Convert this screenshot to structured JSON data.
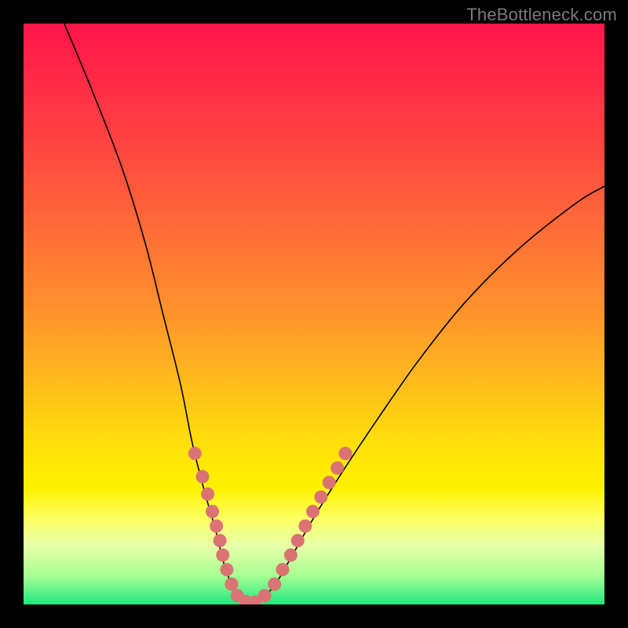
{
  "watermark": "TheBottleneck.com",
  "colors": {
    "black": "#000000",
    "curve": "#000000",
    "marker": "#db7374",
    "gradient_stops": [
      {
        "offset": 0.0,
        "color": "#ff164a"
      },
      {
        "offset": 0.1,
        "color": "#ff2a46"
      },
      {
        "offset": 0.22,
        "color": "#ff4840"
      },
      {
        "offset": 0.35,
        "color": "#ff6b38"
      },
      {
        "offset": 0.48,
        "color": "#ff8e2e"
      },
      {
        "offset": 0.6,
        "color": "#ffb51f"
      },
      {
        "offset": 0.72,
        "color": "#ffde0a"
      },
      {
        "offset": 0.8,
        "color": "#fff200"
      },
      {
        "offset": 0.85,
        "color": "#fcff5e"
      },
      {
        "offset": 0.9,
        "color": "#e6ffa9"
      },
      {
        "offset": 0.95,
        "color": "#a8ff92"
      },
      {
        "offset": 1.0,
        "color": "#21e77f"
      }
    ]
  },
  "chart_data": {
    "type": "line",
    "title": "",
    "xlabel": "",
    "ylabel": "",
    "xlim": [
      0,
      100
    ],
    "ylim": [
      0,
      100
    ],
    "note": "Axes are unlabeled in the image; x/y are normalized 0–100.",
    "series": [
      {
        "name": "bottleneck-curve",
        "x": [
          7,
          12,
          17,
          21,
          24,
          27,
          29,
          31,
          33,
          34.5,
          36,
          37.5,
          40,
          43,
          46,
          50,
          55,
          61,
          68,
          76,
          85,
          95,
          100
        ],
        "y": [
          100,
          88,
          75,
          62,
          50,
          38,
          28,
          20,
          13,
          7,
          3,
          0.5,
          0.5,
          3,
          8,
          15,
          23,
          32,
          42,
          52,
          61,
          69,
          72
        ]
      }
    ],
    "markers": {
      "name": "highlight-dots",
      "points": [
        {
          "x": 29.5,
          "y": 26.0
        },
        {
          "x": 30.8,
          "y": 22.0
        },
        {
          "x": 31.7,
          "y": 19.0
        },
        {
          "x": 32.5,
          "y": 16.0
        },
        {
          "x": 33.2,
          "y": 13.5
        },
        {
          "x": 33.8,
          "y": 11.0
        },
        {
          "x": 34.3,
          "y": 8.5
        },
        {
          "x": 35.0,
          "y": 6.0
        },
        {
          "x": 35.8,
          "y": 3.5
        },
        {
          "x": 36.8,
          "y": 1.5
        },
        {
          "x": 38.3,
          "y": 0.5
        },
        {
          "x": 39.8,
          "y": 0.4
        },
        {
          "x": 41.5,
          "y": 1.5
        },
        {
          "x": 43.2,
          "y": 3.5
        },
        {
          "x": 44.6,
          "y": 6.0
        },
        {
          "x": 46.0,
          "y": 8.5
        },
        {
          "x": 47.2,
          "y": 11.0
        },
        {
          "x": 48.5,
          "y": 13.5
        },
        {
          "x": 49.8,
          "y": 16.0
        },
        {
          "x": 51.2,
          "y": 18.5
        },
        {
          "x": 52.6,
          "y": 21.0
        },
        {
          "x": 54.0,
          "y": 23.5
        },
        {
          "x": 55.4,
          "y": 26.0
        }
      ]
    }
  }
}
